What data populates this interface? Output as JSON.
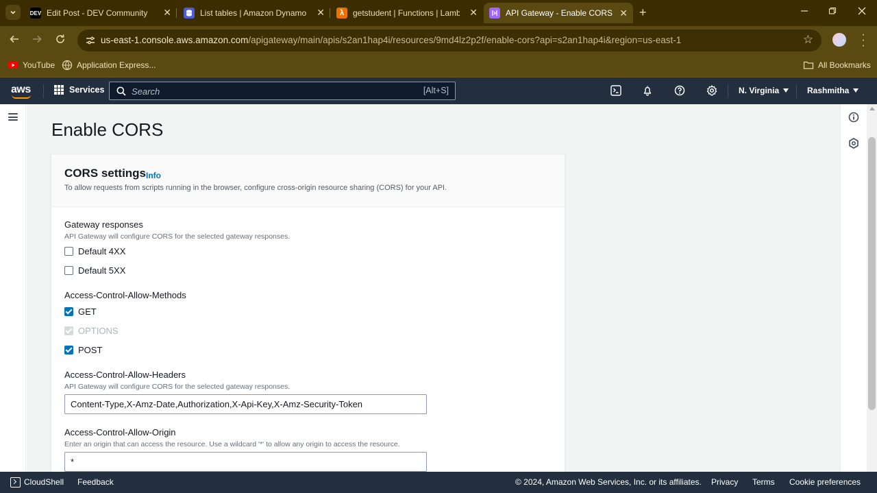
{
  "browser": {
    "tabs": [
      {
        "title": "Edit Post - DEV Community",
        "favicon": "DEV",
        "favicon_bg": "#000000",
        "favicon_fg": "#ffffff"
      },
      {
        "title": "List tables | Amazon DynamoDB",
        "favicon": "",
        "favicon_bg": "#4d5bd6",
        "favicon_fg": "#ffffff"
      },
      {
        "title": "getstudent | Functions | Lambda",
        "favicon": "λ",
        "favicon_bg": "#ed7100",
        "favicon_fg": "#ffffff"
      },
      {
        "title": "API Gateway - Enable CORS",
        "favicon": "",
        "favicon_bg": "#a166ff",
        "favicon_fg": "#ffffff",
        "active": true
      }
    ],
    "url_host": "us-east-1.console.aws.amazon.com",
    "url_path": "/apigateway/main/apis/s2an1hap4i/resources/9md4lz2p2f/enable-cors?api=s2an1hap4i&region=us-east-1",
    "bookmarks": [
      {
        "label": "YouTube",
        "icon": "youtube-icon"
      },
      {
        "label": "Application Express...",
        "icon": "globe-icon"
      }
    ],
    "all_bookmarks": "All Bookmarks"
  },
  "aws_nav": {
    "logo": "aws",
    "services": "Services",
    "search_placeholder": "Search",
    "search_shortcut": "[Alt+S]",
    "region": "N. Virginia",
    "user": "Rashmitha"
  },
  "page": {
    "title": "Enable CORS"
  },
  "cors": {
    "title": "CORS settings",
    "info": "Info",
    "description": "To allow requests from scripts running in the browser, configure cross-origin resource sharing (CORS) for your API.",
    "gateway_responses": {
      "label": "Gateway responses",
      "description": "API Gateway will configure CORS for the selected gateway responses.",
      "options": [
        {
          "label": "Default 4XX",
          "checked": false
        },
        {
          "label": "Default 5XX",
          "checked": false
        }
      ]
    },
    "methods": {
      "label": "Access-Control-Allow-Methods",
      "options": [
        {
          "label": "GET",
          "checked": true,
          "disabled": false
        },
        {
          "label": "OPTIONS",
          "checked": true,
          "disabled": true
        },
        {
          "label": "POST",
          "checked": true,
          "disabled": false
        }
      ]
    },
    "headers": {
      "label": "Access-Control-Allow-Headers",
      "description": "API Gateway will configure CORS for the selected gateway responses.",
      "value": "Content-Type,X-Amz-Date,Authorization,X-Api-Key,X-Amz-Security-Token"
    },
    "origin": {
      "label": "Access-Control-Allow-Origin",
      "description": "Enter an origin that can access the resource. Use a wildcard '*' to allow any origin to access the resource.",
      "value": "*"
    }
  },
  "footer": {
    "cloudshell": "CloudShell",
    "feedback": "Feedback",
    "copyright": "© 2024, Amazon Web Services, Inc. or its affiliates.",
    "privacy": "Privacy",
    "terms": "Terms",
    "cookie": "Cookie preferences"
  },
  "colors": {
    "aws_nav_bg": "#232f3e",
    "accent_orange": "#ff9900",
    "link_blue": "#0073bb",
    "browser_frame": "#5a4a12"
  }
}
